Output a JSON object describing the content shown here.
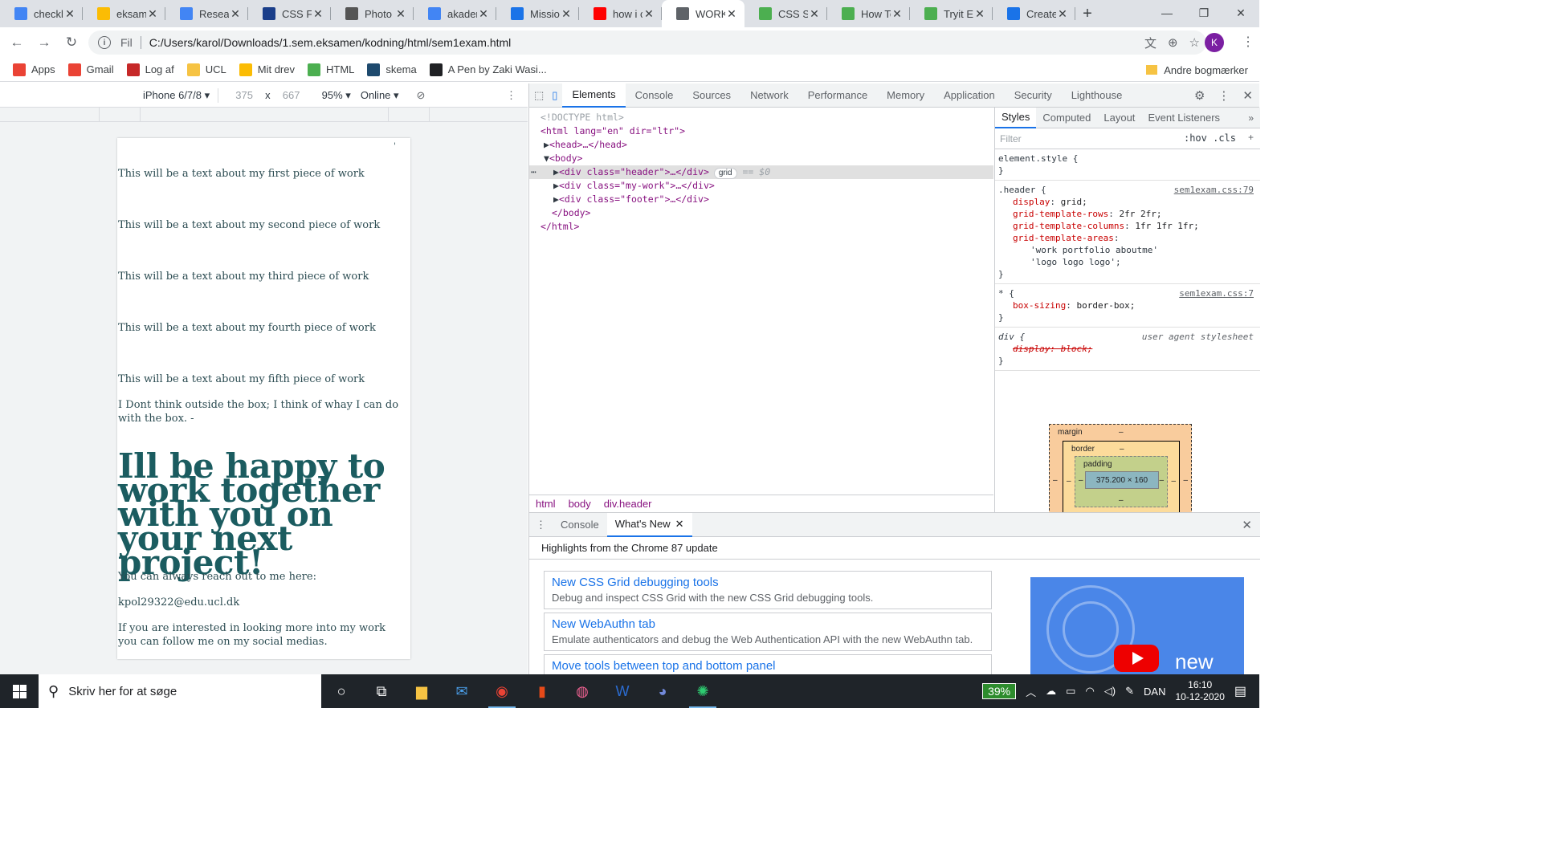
{
  "tabs": [
    {
      "title": "checkli",
      "icon": "docs-icon",
      "color": "#4285f4",
      "active": false
    },
    {
      "title": "eksame",
      "icon": "drive-icon",
      "color": "#fbbc04",
      "active": false
    },
    {
      "title": "Resear",
      "icon": "docs-icon",
      "color": "#4285f4",
      "active": false
    },
    {
      "title": "CSS Fo",
      "icon": "dansk-ols-icon",
      "color": "#1a3e8a",
      "active": false
    },
    {
      "title": "Photo",
      "icon": "photopea-icon",
      "color": "#555555",
      "active": false
    },
    {
      "title": "akader",
      "icon": "docs-icon",
      "color": "#4285f4",
      "active": false
    },
    {
      "title": "Missio",
      "icon": "bracket-icon",
      "color": "#1a73e8",
      "active": false
    },
    {
      "title": "how i c",
      "icon": "youtube-icon",
      "color": "#ff0000",
      "active": false
    },
    {
      "title": "WORK",
      "icon": "globe-icon",
      "color": "#5f6368",
      "active": true
    },
    {
      "title": "CSS St",
      "icon": "w3schools-icon",
      "color": "#4caf50",
      "active": false
    },
    {
      "title": "How Tc",
      "icon": "w3schools-icon",
      "color": "#4caf50",
      "active": false
    },
    {
      "title": "Tryit Ec",
      "icon": "w3schools-icon",
      "color": "#4caf50",
      "active": false
    },
    {
      "title": "Create",
      "icon": "c-icon",
      "color": "#1a73e8",
      "active": false
    }
  ],
  "omnibox": {
    "scheme": "Fil",
    "url": "C:/Users/karol/Downloads/1.sem.eksamen/kodning/html/sem1exam.html"
  },
  "profile_initial": "K",
  "bookmarks": [
    {
      "label": "Apps",
      "icon": "apps-grid-icon",
      "color": "#ea4335"
    },
    {
      "label": "Gmail",
      "icon": "gmail-icon",
      "color": "#ea4335"
    },
    {
      "label": "Log af",
      "icon": "e-icon",
      "color": "#c62828"
    },
    {
      "label": "UCL",
      "icon": "folder-icon",
      "color": "#f6c343"
    },
    {
      "label": "Mit drev",
      "icon": "drive-icon",
      "color": "#fbbc04"
    },
    {
      "label": "HTML",
      "icon": "w3schools-icon",
      "color": "#4caf50"
    },
    {
      "label": "skema",
      "icon": "te-icon",
      "color": "#1e4a6e"
    },
    {
      "label": "A Pen by Zaki Wasi...",
      "icon": "github-icon",
      "color": "#202124"
    }
  ],
  "other_bookmarks": "Andre bogmærker",
  "device_toolbar": {
    "device": "iPhone 6/7/8",
    "width": "375",
    "times": "x",
    "height": "667",
    "zoom": "95%",
    "throttle": "Online"
  },
  "page": {
    "work_texts": [
      "This will be a text about my first piece of work",
      "This will be a text about my second piece of work",
      "This will be a text about my third piece of work",
      "This will be a text about my fourth piece of work",
      "This will be a text about my fifth piece of work"
    ],
    "quote": "I Dont think outside the box; I think of whay I can do with the box. -",
    "headline": "Ill be happy to work together with you on your next project!",
    "reach_out": "You can always reach out to me here:",
    "email": "kpol29322@edu.ucl.dk",
    "social": "If you are interested in looking more into my work you can follow me on my social medias.",
    "stray_mark": "'"
  },
  "devtools": {
    "tabs": [
      "Elements",
      "Console",
      "Sources",
      "Network",
      "Performance",
      "Memory",
      "Application",
      "Security",
      "Lighthouse"
    ],
    "active_tab": "Elements",
    "dom": {
      "doctype": "<!DOCTYPE html>",
      "html_open": "<html lang=\"en\" dir=\"ltr\">",
      "head": "<head>…</head>",
      "body_open": "<body>",
      "header_div": "<div class=\"header\">…</div>",
      "grid_badge": "grid",
      "selected_marker": "== $0",
      "mywork_div": "<div class=\"my-work\">…</div>",
      "footer_div": "<div class=\"footer\">…</div>",
      "body_close": "</body>",
      "html_close": "</html>"
    },
    "breadcrumbs": [
      "html",
      "body",
      "div.header"
    ],
    "styles_tabs": [
      "Styles",
      "Computed",
      "Layout",
      "Event Listeners"
    ],
    "filter_placeholder": "Filter",
    "filter_buttons": ":hov .cls",
    "rules": {
      "element_style": "element.style {",
      "close": "}",
      "header_selector": ".header {",
      "header_src": "sem1exam.css:79",
      "header_decls": [
        {
          "prop": "display",
          "val": "grid;"
        },
        {
          "prop": "grid-template-rows",
          "val": "2fr 2fr;"
        },
        {
          "prop": "grid-template-columns",
          "val": "1fr 1fr 1fr;"
        },
        {
          "prop": "grid-template-areas",
          "val": ""
        }
      ],
      "areas_line1": "'work portfolio aboutme'",
      "areas_line2": "'logo logo logo';",
      "star_selector": "* {",
      "star_src": "sem1exam.css:7",
      "star_prop": "box-sizing",
      "star_val": "border-box;",
      "div_selector": "div {",
      "div_src": "user agent stylesheet",
      "div_decl": "display: block;"
    },
    "box_model": {
      "margin": "margin",
      "border": "border",
      "padding": "padding",
      "content": "375.200 × 160",
      "dash": "–"
    },
    "drawer": {
      "tabs": [
        "Console",
        "What's New"
      ],
      "active": "What's New",
      "highlights": "Highlights from the Chrome 87 update",
      "items": [
        {
          "title": "New CSS Grid debugging tools",
          "desc": "Debug and inspect CSS Grid with the new CSS Grid debugging tools."
        },
        {
          "title": "New WebAuthn tab",
          "desc": "Emulate authenticators and debug the Web Authentication API with the new WebAuthn tab."
        },
        {
          "title": "Move tools between top and bottom panel",
          "desc": ""
        }
      ],
      "promo_text": "new"
    }
  },
  "taskbar": {
    "search_placeholder": "Skriv her for at søge",
    "battery": "39%",
    "language": "DAN",
    "time": "16:10",
    "date": "10-12-2020"
  }
}
